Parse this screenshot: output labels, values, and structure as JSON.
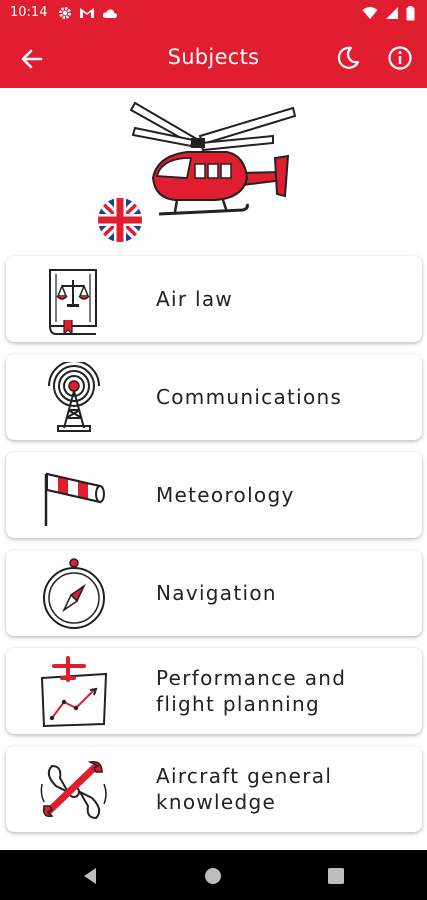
{
  "status_bar": {
    "time": "10:14",
    "left_icons": [
      "gear-icon",
      "gmail-icon",
      "cloud-icon"
    ],
    "right_icons": [
      "wifi-icon",
      "signal-icon",
      "battery-icon"
    ]
  },
  "app_bar": {
    "title": "Subjects",
    "back_icon": "back-arrow-icon",
    "actions": [
      "moon-icon",
      "info-icon"
    ]
  },
  "hero": {
    "image": "helicopter-illustration",
    "flag": "uk-flag-icon"
  },
  "subjects": [
    {
      "label": "Air law",
      "icon": "law-book-icon"
    },
    {
      "label": "Communications",
      "icon": "radio-tower-icon"
    },
    {
      "label": "Meteorology",
      "icon": "windsock-icon"
    },
    {
      "label": "Navigation",
      "icon": "compass-icon"
    },
    {
      "label": "Performance and\nflight planning",
      "icon": "flight-chart-icon"
    },
    {
      "label": "Aircraft general\nknowledge",
      "icon": "propeller-wrench-icon"
    }
  ],
  "colors": {
    "accent": "#e11d30",
    "text": "#222222",
    "navbar": "#000000"
  },
  "nav_bar": [
    "back-triangle-icon",
    "home-circle-icon",
    "recents-square-icon"
  ]
}
